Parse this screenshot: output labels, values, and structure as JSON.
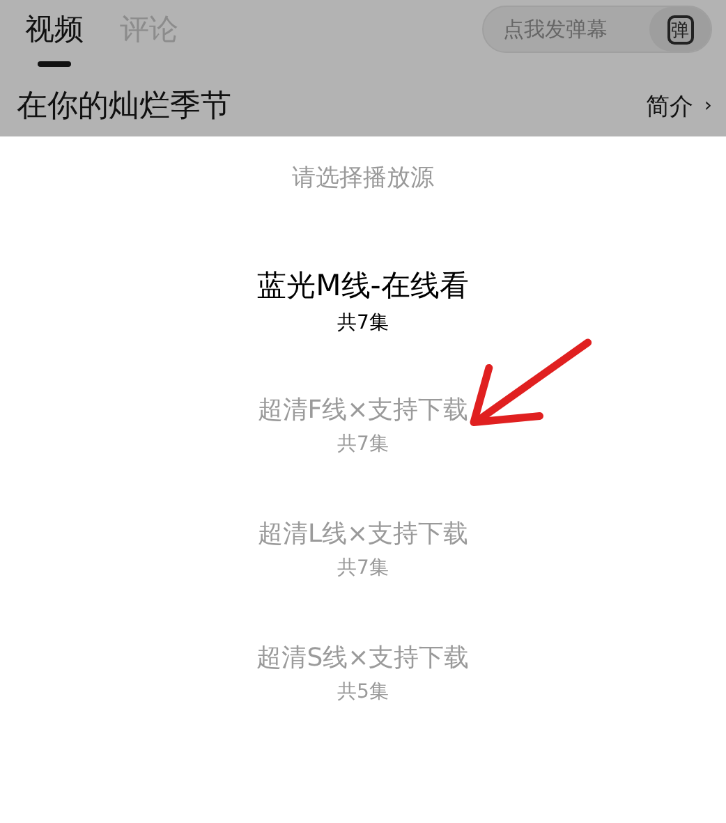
{
  "tabs": [
    {
      "label": "视频",
      "selected": true
    },
    {
      "label": "评论",
      "selected": false
    }
  ],
  "danmaku": {
    "placeholder": "点我发弹幕",
    "button": "弹"
  },
  "title": "在你的灿烂季节",
  "intro_link": {
    "label": "简介",
    "chevron": "›"
  },
  "sheet": {
    "heading": "请选择播放源",
    "sources": [
      {
        "name": "蓝光M线-在线看",
        "count": "共7集",
        "selected": true
      },
      {
        "name": "超清F线×支持下载",
        "count": "共7集",
        "selected": false
      },
      {
        "name": "超清L线×支持下载",
        "count": "共7集",
        "selected": false
      },
      {
        "name": "超清S线×支持下载",
        "count": "共5集",
        "selected": false
      }
    ]
  }
}
